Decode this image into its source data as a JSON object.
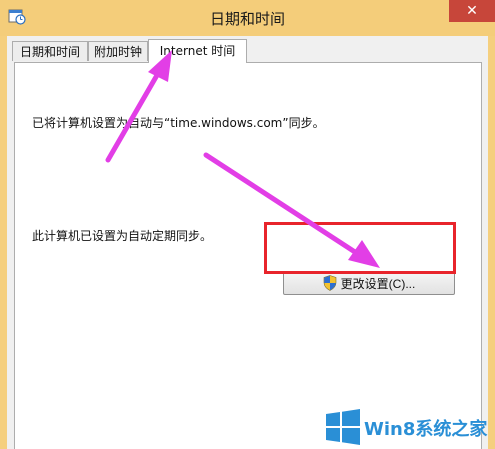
{
  "window": {
    "title": "日期和时间",
    "close_glyph": "✕"
  },
  "tabs": [
    {
      "label": "日期和时间",
      "active": false
    },
    {
      "label": "附加时钟",
      "active": false
    },
    {
      "label": "Internet 时间",
      "active": true
    }
  ],
  "panel": {
    "sync_text": "已将计算机设置为自动与“time.windows.com”同步。",
    "status_text": "此计算机已设置为自动定期同步。",
    "change_button_label": "更改设置(C)..."
  },
  "icons": {
    "app": "calendar-clock-icon",
    "button": "uac-shield-icon"
  },
  "colors": {
    "title_bar": "#f4cd7a",
    "close_button": "#c7463a",
    "highlight_box": "#e8242b",
    "annotation_arrow": "#e23ee6",
    "watermark": "#2a8fd6"
  },
  "watermark": {
    "text": "Win8系统之家"
  }
}
